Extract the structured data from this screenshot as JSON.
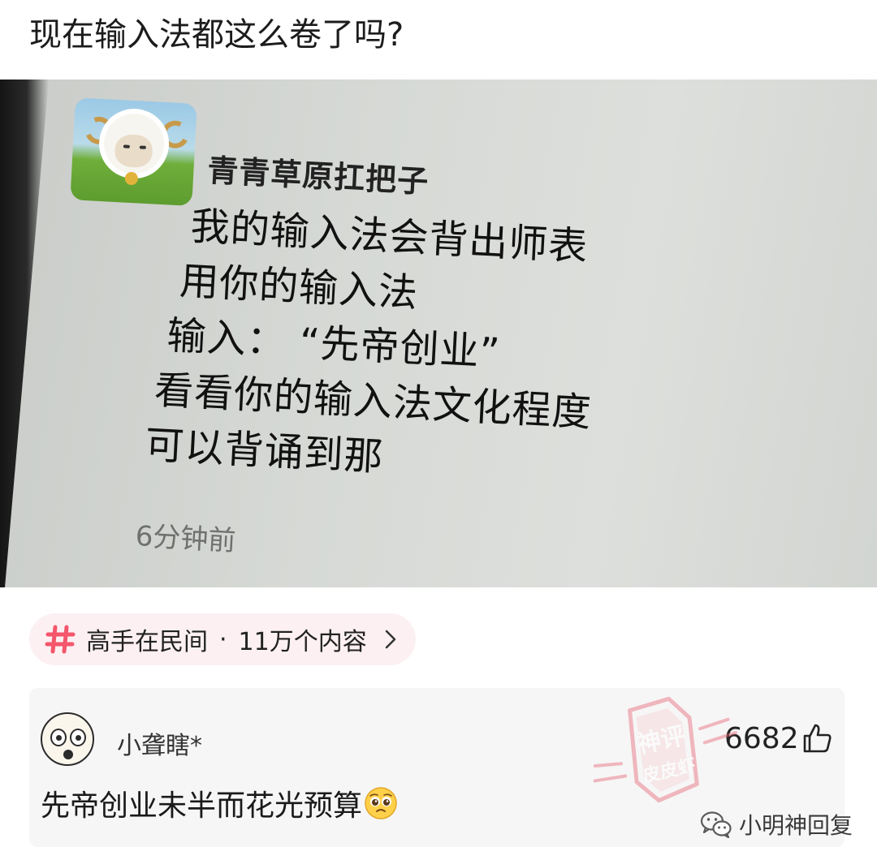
{
  "post": {
    "title": "现在输入法都这么卷了吗?"
  },
  "photo": {
    "nickname": "青青草原扛把子",
    "lines": [
      "我的输入法会背出师表",
      "用你的输入法",
      "输入：  “先帝创业”",
      "看看你的输入法文化程度",
      "可以背诵到那"
    ],
    "time": "6分钟前",
    "avatar_icon": "sheep-cartoon-avatar"
  },
  "topic": {
    "icon": "hash-icon",
    "name": "高手在民间",
    "separator": "·",
    "count": "11万个内容",
    "chevron": "chevron-right-icon",
    "colors": {
      "background": "#fdf0f2",
      "hash": "#f4566b"
    }
  },
  "comment": {
    "username": "小聋瞎*",
    "text": "先帝创业未半而花光预算",
    "emoji": "pleading-face-emoji",
    "likes": "6682",
    "like_icon": "thumbs-up-icon"
  },
  "watermark": {
    "top": "神评",
    "bottom": "皮皮虾",
    "color": "#e86a7a"
  },
  "attribution": {
    "icon": "wechat-icon",
    "text": "小明神回复"
  }
}
